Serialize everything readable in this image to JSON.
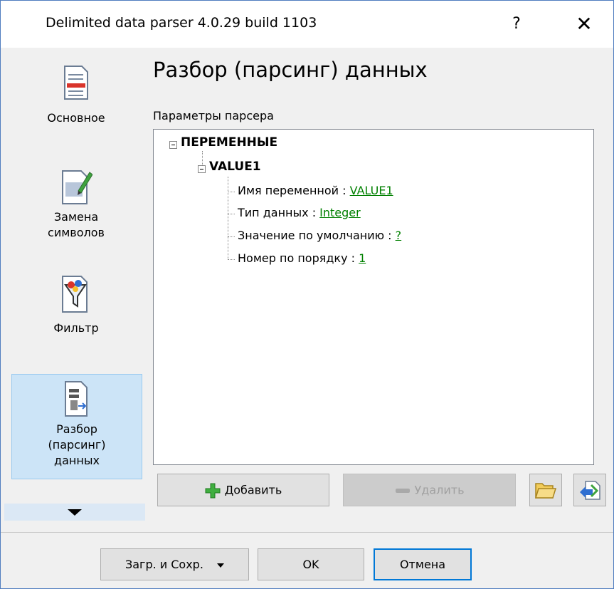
{
  "window": {
    "title": "Delimited data parser 4.0.29 build 1103",
    "help": "?",
    "close": "✕"
  },
  "sidebar": {
    "items": [
      {
        "label": "Основное",
        "icon": "document-icon"
      },
      {
        "label": "Замена\nсимволов",
        "icon": "pencil-document-icon"
      },
      {
        "label": "Фильтр",
        "icon": "funnel-icon"
      },
      {
        "label": "Разбор\n(парсинг)\nданных",
        "icon": "parser-icon",
        "selected": true
      }
    ]
  },
  "main": {
    "title": "Разбор (парсинг) данных",
    "group_label": "Параметры парсера",
    "tree": {
      "root": "ПЕРЕМЕННЫЕ",
      "child": "VALUE1",
      "props": [
        {
          "label": "Имя переменной : ",
          "value": "VALUE1"
        },
        {
          "label": "Тип данных : ",
          "value": "Integer"
        },
        {
          "label": "Значение по умолчанию : ",
          "value": "?"
        },
        {
          "label": "Номер по порядку : ",
          "value": "1"
        }
      ]
    },
    "buttons": {
      "add": "Добавить",
      "delete": "Удалить"
    }
  },
  "footer": {
    "load_save": "Загр. и Сохр.",
    "ok": "OK",
    "cancel": "Отмена"
  },
  "colors": {
    "accent": "#0078d7",
    "selected_bg": "#cce4f7",
    "link": "#008000"
  }
}
